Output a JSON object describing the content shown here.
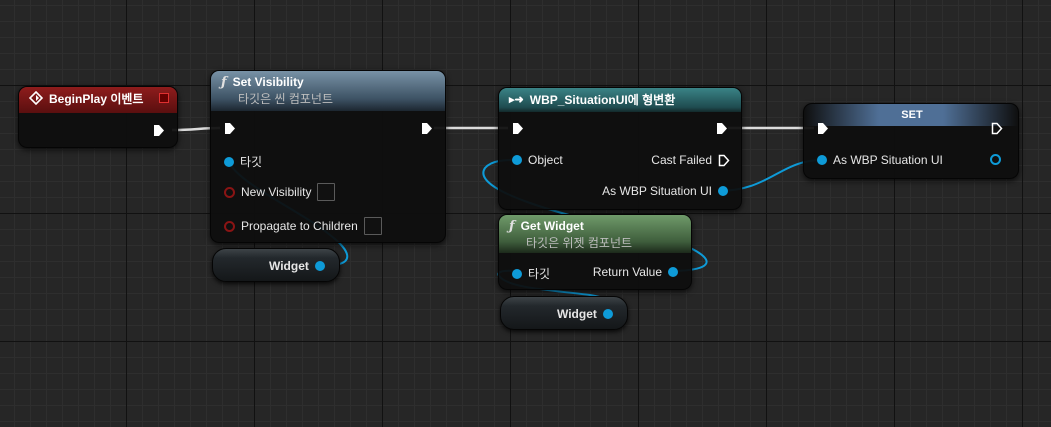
{
  "nodes": {
    "begin_play": {
      "title": "BeginPlay 이벤트",
      "header_color": "#7a1616"
    },
    "set_visibility": {
      "title": "Set Visibility",
      "subtitle": "타깃은 씬 컴포넌트",
      "icon": "function-icon",
      "header_color": "#5f7a8f",
      "pins": {
        "target": "타깃",
        "new_visibility": "New Visibility",
        "propagate": "Propagate to Children"
      }
    },
    "cast": {
      "title": "WBP_SituationUI에 형변환",
      "header_color": "#2b6a6e",
      "pins": {
        "object": "Object",
        "cast_failed": "Cast Failed",
        "as_wbp": "As WBP Situation UI"
      }
    },
    "set": {
      "title": "SET",
      "header_color": "#5c7aa0",
      "pins": {
        "as_wbp": "As WBP Situation UI"
      }
    },
    "get_widget": {
      "title": "Get Widget",
      "subtitle": "타깃은 위젯 컴포넌트",
      "icon": "function-icon",
      "header_color": "#5f8a5a",
      "pins": {
        "target": "타깃",
        "return_value": "Return Value"
      }
    }
  },
  "variables": {
    "widget_1": "Widget",
    "widget_2": "Widget"
  },
  "colors": {
    "object_pin": "#0e9bd8",
    "exec_wire": "#dcdcdc",
    "bool_pin": "#8a1414"
  }
}
